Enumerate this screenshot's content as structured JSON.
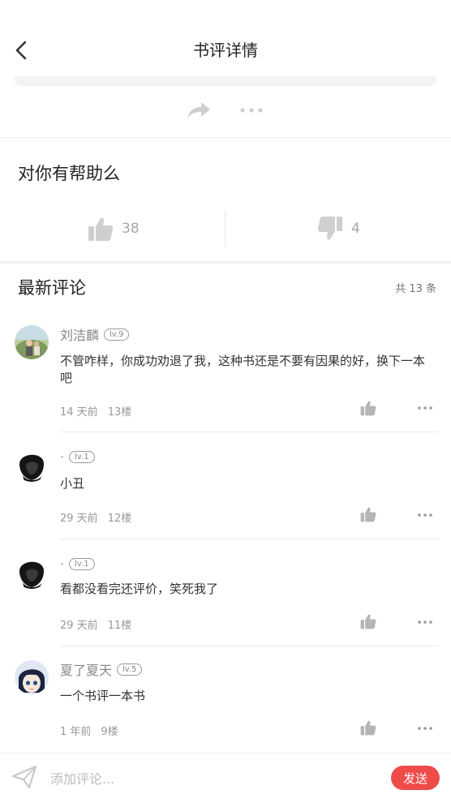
{
  "header": {
    "title": "书评详情"
  },
  "helpful": {
    "title": "对你有帮助么",
    "up_count": "38",
    "down_count": "4"
  },
  "comments_section": {
    "title": "最新评论",
    "count_label": "共 13 条",
    "items": [
      {
        "name": "刘洁麟",
        "level": "lv.9",
        "text": "不管咋样，你成功劝退了我，这种书还是不要有因果的好，换下一本吧",
        "time": "14 天前",
        "floor": "13楼"
      },
      {
        "name": "·",
        "level": "lv.1",
        "text": "小丑",
        "time": "29 天前",
        "floor": "12楼"
      },
      {
        "name": "·",
        "level": "lv.1",
        "text": "看都没看完还评价，笑死我了",
        "time": "29 天前",
        "floor": "11楼"
      },
      {
        "name": "夏了夏天",
        "level": "lv.5",
        "text": "一个书评一本书",
        "time": "1 年前",
        "floor": "9楼"
      }
    ]
  },
  "composer": {
    "placeholder": "添加评论...",
    "send_label": "发送"
  },
  "colors": {
    "accent": "#ee4b4b",
    "text_muted": "#999999"
  }
}
